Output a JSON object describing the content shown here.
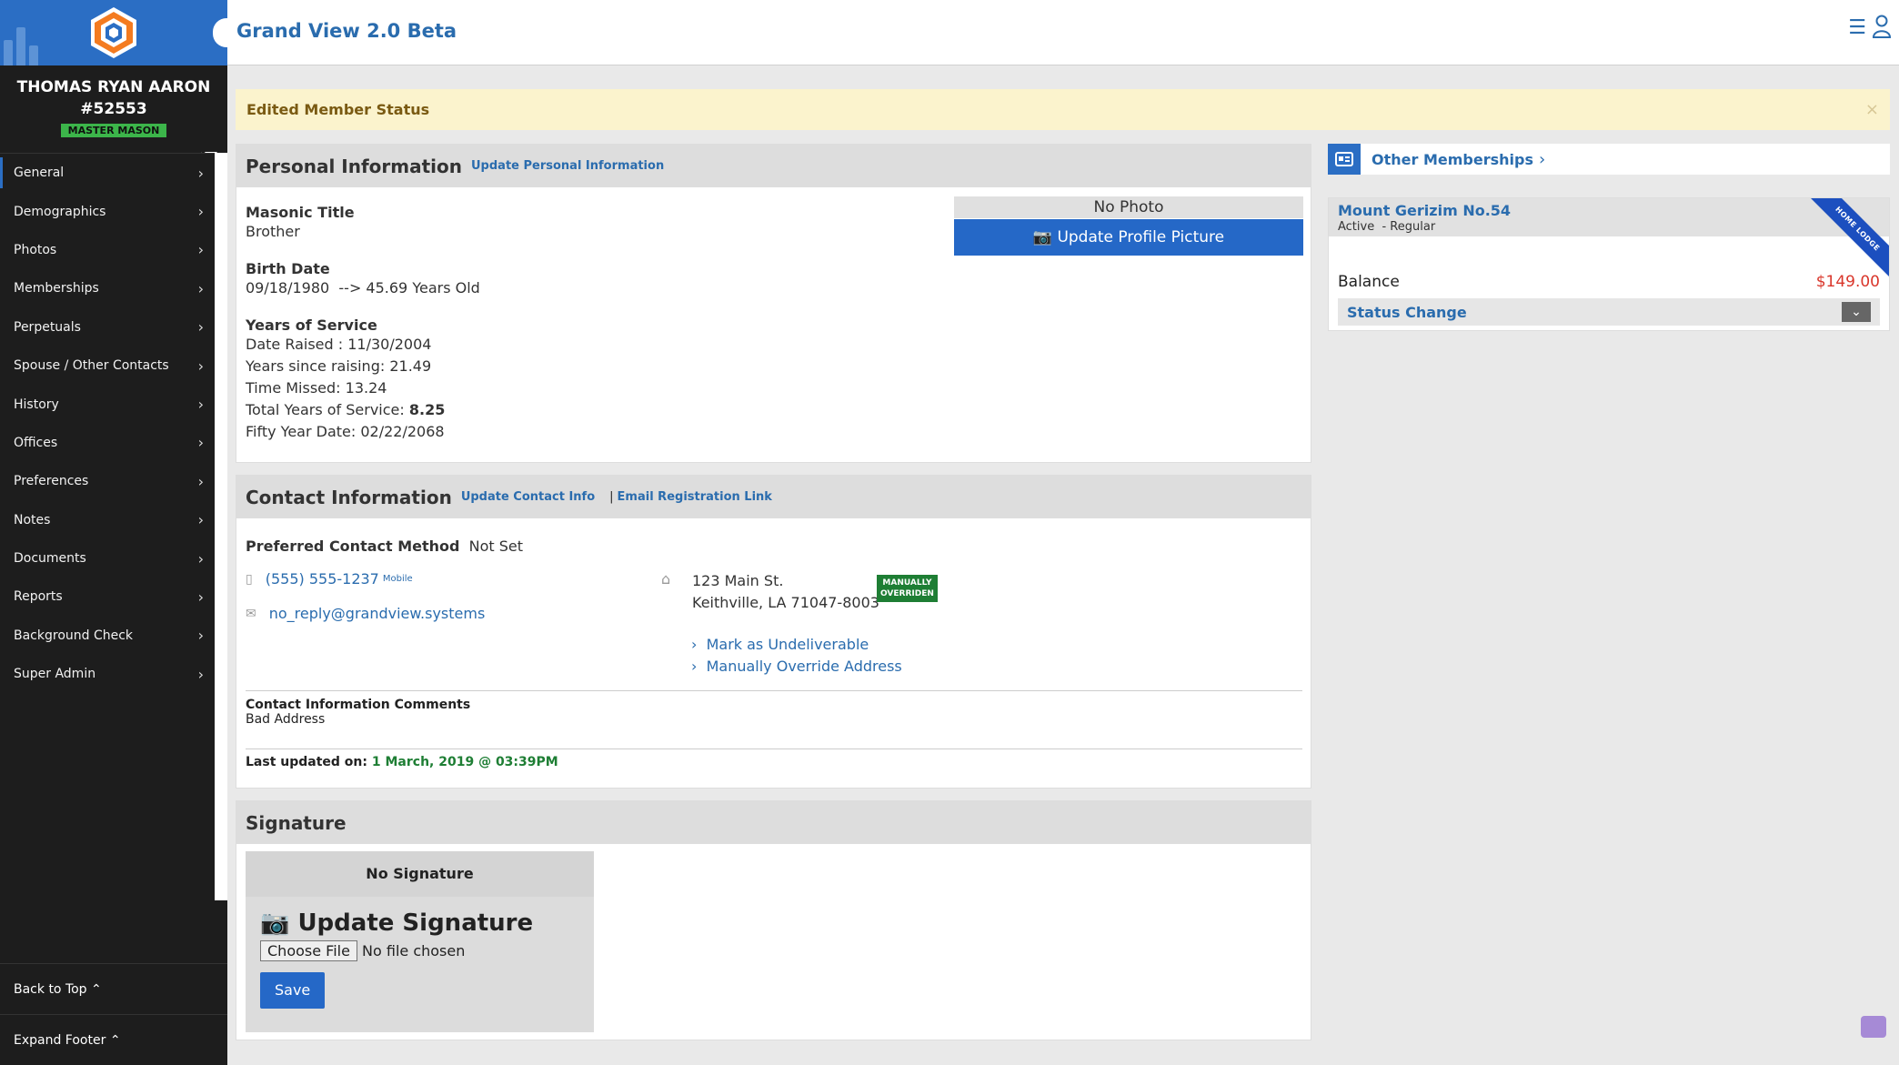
{
  "app": {
    "title": "Grand View 2.0 Beta"
  },
  "sidebar": {
    "member_name": "THOMAS RYAN AARON",
    "member_number": "#52553",
    "badge": "MASTER MASON",
    "items": [
      {
        "label": "General"
      },
      {
        "label": "Demographics"
      },
      {
        "label": "Photos"
      },
      {
        "label": "Memberships"
      },
      {
        "label": "Perpetuals"
      },
      {
        "label": "Spouse / Other Contacts"
      },
      {
        "label": "History"
      },
      {
        "label": "Offices"
      },
      {
        "label": "Preferences"
      },
      {
        "label": "Notes"
      },
      {
        "label": "Documents"
      },
      {
        "label": "Reports"
      },
      {
        "label": "Background Check"
      },
      {
        "label": "Super Admin"
      }
    ],
    "back_to_top": "Back to Top",
    "expand_footer": "Expand Footer"
  },
  "alert": {
    "text": "Edited Member Status",
    "close": "×"
  },
  "personal": {
    "title": "Personal Information",
    "update_link": "Update Personal Information",
    "masonic_title_label": "Masonic Title",
    "masonic_title": "Brother",
    "birth_label": "Birth Date",
    "birth_value": "09/18/1980  --> 45.69 Years Old",
    "service_label": "Years of Service",
    "date_raised": "Date Raised : 11/30/2004",
    "years_since": "Years since raising: 21.49",
    "time_missed": "Time Missed: 13.24",
    "total_label": "Total Years of Service:",
    "total_value": "8.25",
    "fifty_year": "Fifty Year Date: 02/22/2068",
    "no_photo": "No Photo",
    "update_photo": "Update Profile Picture"
  },
  "contact": {
    "title": "Contact Information",
    "update_link": "Update Contact Info",
    "separator": "|",
    "email_reg_link": "Email Registration Link",
    "pref_label": "Preferred Contact Method",
    "pref_value": "Not Set",
    "phone": "(555) 555-1237",
    "phone_type": "Mobile",
    "email": "no_reply@grandview.systems",
    "address_line1": "123 Main St.",
    "address_line2": "Keithville, LA 71047-8003",
    "override_tag_1": "MANUALLY",
    "override_tag_2": "OVERRIDEN",
    "mark_undeliverable": "Mark as Undeliverable",
    "manual_override": "Manually Override Address",
    "comments_label": "Contact Information Comments",
    "comments": "Bad Address",
    "last_updated_label": "Last updated on:",
    "last_updated_value": "1 March, 2019 @ 03:39PM"
  },
  "signature": {
    "title": "Signature",
    "no_signature": "No Signature",
    "update_label": "Update Signature",
    "choose_file": "Choose File",
    "no_file": "No file chosen",
    "save": "Save"
  },
  "memberships": {
    "header": "Other Memberships",
    "lodge_name": "Mount Gerizim No.54",
    "lodge_status": "Active  - Regular",
    "ribbon": "HOME LODGE",
    "balance_label": "Balance",
    "balance_value": "$149.00",
    "status_change": "Status Change"
  },
  "colors": {
    "brand_blue": "#2b6ec4",
    "link_blue": "#2a6cae",
    "sidebar_bg": "#1d1d1d",
    "alert_bg": "#fbf3cd",
    "balance_red": "#d9362b",
    "badge_green": "#3cb54a"
  }
}
